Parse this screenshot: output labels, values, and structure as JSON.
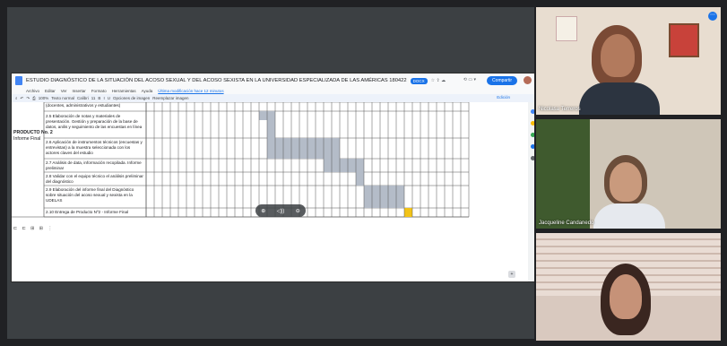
{
  "document": {
    "title": "ESTUDIO DIAGNÓSTICO DE LA SITUACIÓN DEL ACOSO SEXUAL Y DEL ACOSO SEXISTA EN LA UNIVERSIDAD ESPECIALIZADA DE LAS AMÉRICAS 180422",
    "badge": "DOCX",
    "share_label": "Compartir",
    "edit_mode_label": "Edición",
    "menu": [
      "Archivo",
      "Editar",
      "Ver",
      "Insertar",
      "Formato",
      "Herramientas",
      "Ayuda"
    ],
    "last_edit": "Última modificación hace 12 minutos",
    "toolbar_text": [
      "100%",
      "Texto normal",
      "Calibri",
      "11"
    ],
    "toolbar_extra": [
      "Opciones de imagen",
      "Reemplazar imagen"
    ],
    "left_label": "PRODUCTO No. 2",
    "left_sublabel": "Informe Final",
    "rows": [
      "(docentes, administrativos y estudiantes)",
      "2.5 Elaboración de notas y materiales de presentación. Gestión y preparación de la base de datos, anilis y seguimiento de las encuestas en línea",
      "2.6 Aplicación de instrumentos técnicos (encuestas y entrevistas) a la muestra seleccionada con los actores claves del estudio",
      "2.7 Análisis de data, información recopilada. Informe preliminar",
      "2.8 Validar con el equipo técnico el análisis preliminar del diagnóstico",
      "2.9 Elaboración del informe final del Diagnóstico sobre situación del acoso sexual y sexista en la UDELAS",
      "2.10 Entrega de Producto Nº2 - Informe Final"
    ],
    "zoom_controls": [
      "⊕",
      "◁))",
      "⊖"
    ],
    "bottom_tools": "⊏ ⊏ ⊞ ⊞ ⋮"
  },
  "chart_data": {
    "type": "gantt",
    "columns": 40,
    "tasks": [
      {
        "name": "2.5",
        "bars": [
          {
            "start": 14,
            "end": 16,
            "color": "#b4bcc8"
          }
        ]
      },
      {
        "name": "2.5b",
        "bars": [
          {
            "start": 15,
            "end": 16,
            "color": "#b4bcc8"
          }
        ]
      },
      {
        "name": "2.6",
        "bars": [
          {
            "start": 15,
            "end": 24,
            "color": "#b4bcc8"
          }
        ]
      },
      {
        "name": "2.7",
        "bars": [
          {
            "start": 22,
            "end": 27,
            "color": "#b4bcc8"
          }
        ]
      },
      {
        "name": "2.8",
        "bars": [
          {
            "start": 26,
            "end": 27,
            "color": "#b4bcc8"
          }
        ]
      },
      {
        "name": "2.9",
        "bars": [
          {
            "start": 27,
            "end": 32,
            "color": "#b4bcc8"
          }
        ]
      },
      {
        "name": "2.10",
        "bars": [
          {
            "start": 32,
            "end": 33,
            "color": "#f2c318"
          }
        ]
      }
    ]
  },
  "participants": [
    {
      "name": "Nicolasa Terreros"
    },
    {
      "name": "Jacqueline Candanedo"
    },
    {
      "name": ""
    }
  ],
  "colors": {
    "accent": "#1a73e8",
    "gantt_bar": "#b4bcc8",
    "deliverable": "#f2c318"
  }
}
